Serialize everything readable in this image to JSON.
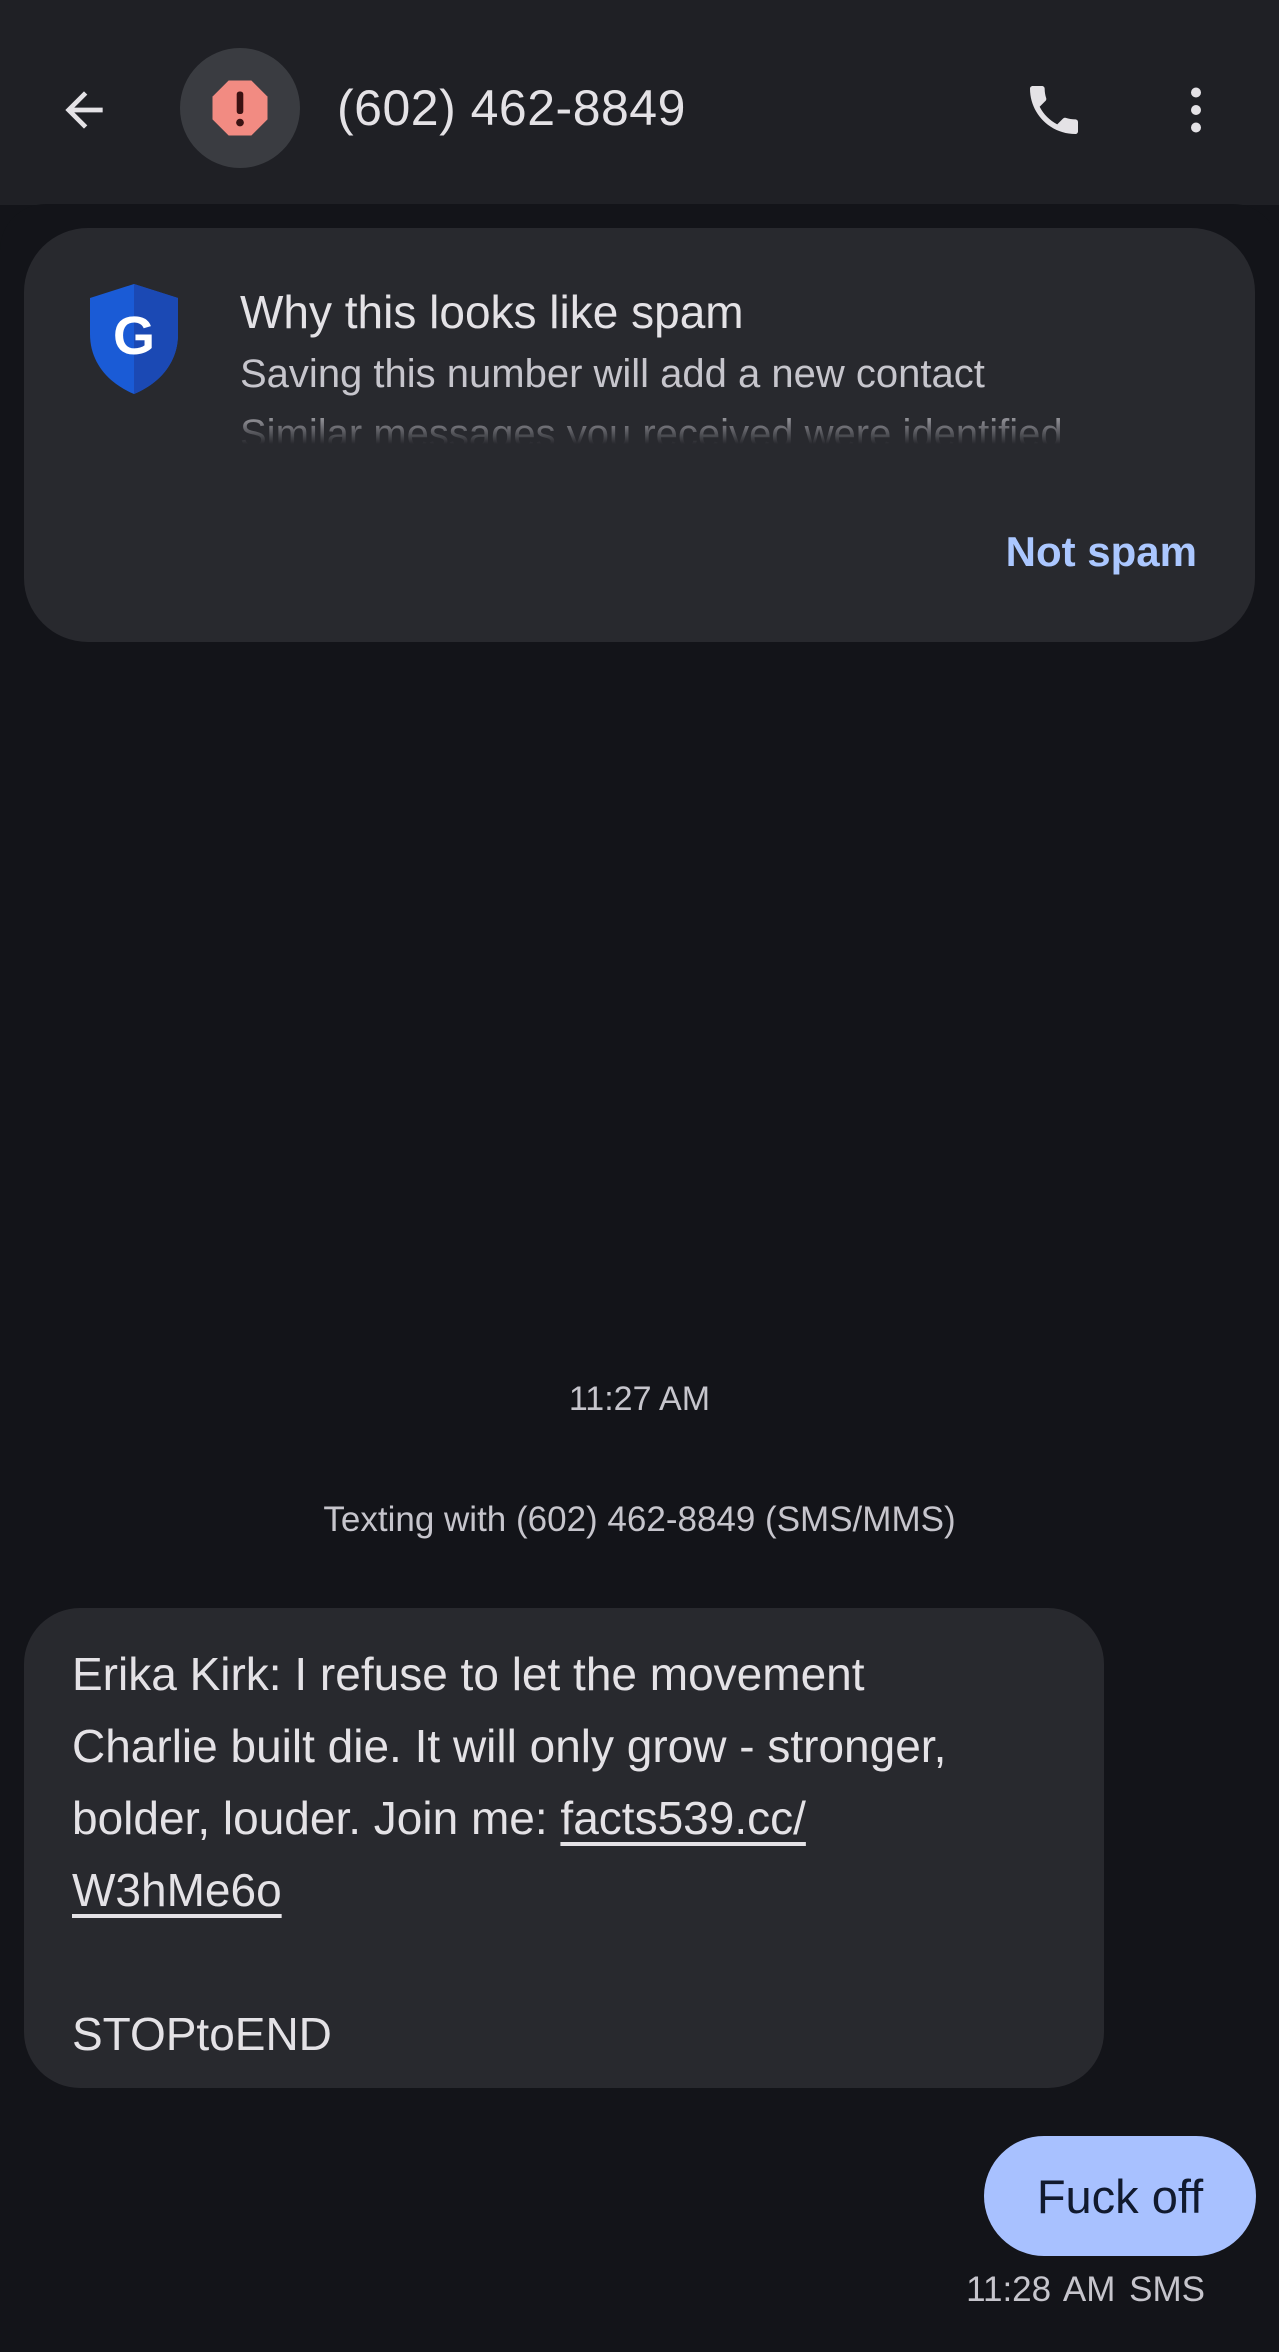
{
  "header": {
    "title": "(602) 462-8849",
    "back_icon": "arrow-back-icon",
    "avatar_icon": "spam-warning-icon",
    "call_icon": "phone-icon",
    "more_icon": "more-vert-icon"
  },
  "spam_card": {
    "title": "Why this looks like spam",
    "reasons": [
      "Saving this number will add a new contact",
      "Similar messages you received were identified"
    ],
    "action_label": "Not spam",
    "icon": "google-shield-icon",
    "shield_letter": "G"
  },
  "conversation": {
    "time_label": "11:27 AM",
    "texting_with": "Texting with (602) 462-8849 (SMS/MMS)",
    "incoming": {
      "lines": [
        "Erika Kirk: I refuse to let the movement",
        "Charlie built die. It will only grow - stronger,",
        "bolder, louder. Join me: "
      ],
      "link_part1": "facts539.cc/",
      "link_part2": "W3hMe6o",
      "footer": "STOPtoEND"
    },
    "outgoing": {
      "text": "Fuck off",
      "time": "11:28 AM",
      "type": "SMS"
    }
  },
  "colors": {
    "background": "#131419",
    "appbar": "#1f2025",
    "card": "#28292e",
    "accent": "#abc7ff",
    "outgoing_bubble": "#a8c1ff",
    "warning": "#f28b82",
    "shield_blue": "#1a5bd6"
  }
}
